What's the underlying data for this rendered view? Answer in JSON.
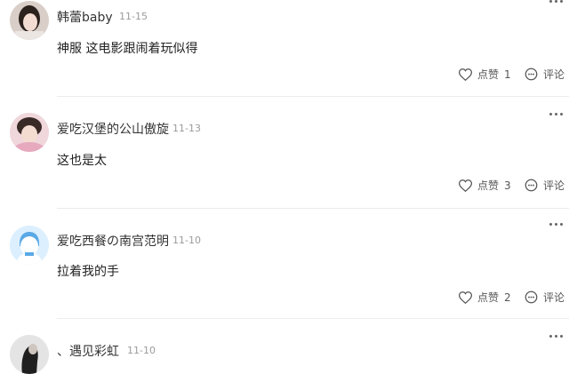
{
  "comments": [
    {
      "username": "韩蕾baby",
      "date": "11-15",
      "text": "神服 这电影跟闹着玩似得",
      "like_label": "点赞",
      "like_count": "1",
      "reply_label": "评论"
    },
    {
      "username": "爱吃汉堡的公山傲旋",
      "date": "11-13",
      "text": "这也是太",
      "like_label": "点赞",
      "like_count": "3",
      "reply_label": "评论"
    },
    {
      "username": "爱吃西餐の南宫范明",
      "date": "11-10",
      "text": "拉着我的手",
      "like_label": "点赞",
      "like_count": "2",
      "reply_label": "评论"
    },
    {
      "username": "、遇见彩虹",
      "date": "11-10"
    }
  ]
}
